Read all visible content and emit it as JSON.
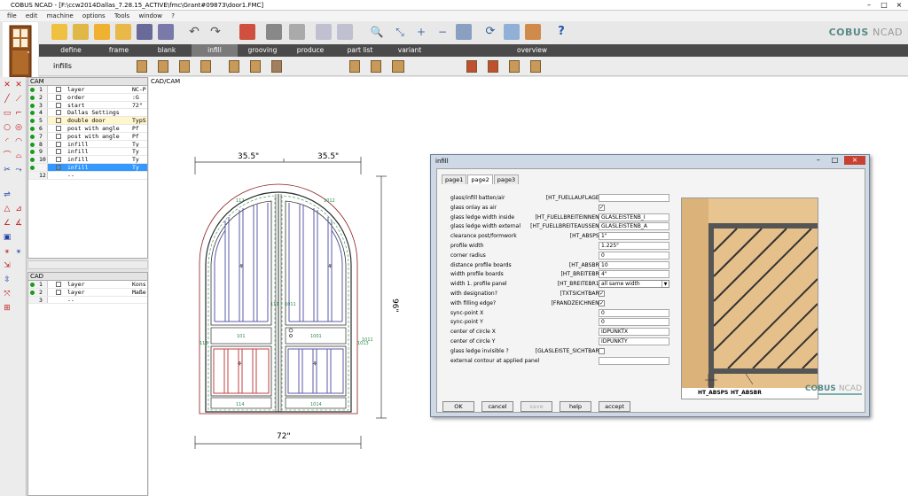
{
  "window": {
    "title": "COBUS NCAD - [F:\\ccw2014Dallas_7.28.15_ACTIVE\\fmc\\Grant#09873\\door1.FMC]",
    "minimize": "–",
    "maximize": "□",
    "close": "×"
  },
  "menu": [
    "file",
    "edit",
    "machine",
    "options",
    "Tools",
    "window",
    "?"
  ],
  "brand": {
    "a": "COBUS",
    "b": "NCAD"
  },
  "tabs": [
    {
      "label": "define"
    },
    {
      "label": "frame"
    },
    {
      "label": "blank"
    },
    {
      "label": "infill",
      "active": true
    },
    {
      "label": "grooving"
    },
    {
      "label": "produce"
    },
    {
      "label": "part list"
    },
    {
      "label": "variant"
    },
    {
      "label": "overview"
    }
  ],
  "subbar": {
    "label": "infills"
  },
  "cam": {
    "header": "CAM",
    "rows": [
      {
        "n": "1",
        "name": "layer",
        "val": "NC-P"
      },
      {
        "n": "2",
        "name": "order",
        "val": ":G"
      },
      {
        "n": "3",
        "name": "start",
        "val": "72\" :"
      },
      {
        "n": "4",
        "name": "Dallas Settings",
        "val": ""
      },
      {
        "n": "5",
        "name": "double door",
        "val": "TypS"
      },
      {
        "n": "6",
        "name": "post with angle",
        "val": "Pf"
      },
      {
        "n": "7",
        "name": "post with angle",
        "val": "Pf"
      },
      {
        "n": "8",
        "name": "infill",
        "val": "Ty"
      },
      {
        "n": "9",
        "name": "infill",
        "val": "Ty"
      },
      {
        "n": "10",
        "name": "infill",
        "val": "Ty"
      },
      {
        "n": "11",
        "name": "infill",
        "val": "Ty"
      },
      {
        "n": "12",
        "name": "--",
        "val": ""
      }
    ]
  },
  "cad": {
    "header": "CAD",
    "rows": [
      {
        "n": "1",
        "name": "layer",
        "val": "Kons"
      },
      {
        "n": "2",
        "name": "layer",
        "val": "Maße"
      },
      {
        "n": "3",
        "name": "--",
        "val": ""
      }
    ]
  },
  "viewport": {
    "label": "CAD/CAM"
  },
  "drawing": {
    "dim_left": "35.5\"",
    "dim_right": "35.5\"",
    "dim_bottom": "72\"",
    "dim_height": "96\"",
    "labels": [
      "112",
      "1012",
      "111",
      "1011",
      "101",
      "1001",
      "113",
      "1013",
      "1011",
      "114",
      "1014"
    ]
  },
  "dialog": {
    "title": "infill",
    "tabs": [
      "page1",
      "page2",
      "page3"
    ],
    "active_tab": "page2",
    "fields": [
      {
        "label": "glass/infill batten/air",
        "code": "[HT_FUELLAUFLAGE]",
        "type": "input",
        "value": ""
      },
      {
        "label": "glass onlay as air",
        "code": "",
        "type": "check",
        "value": "✓"
      },
      {
        "label": "glass ledge width inside",
        "code": "[HT_FUELLBREITEINNEN]",
        "type": "input",
        "value": "GLASLEISTENB_I"
      },
      {
        "label": "glass ledge width external",
        "code": "[HT_FUELLBREITEAUSSEN]",
        "type": "input",
        "value": "GLASLEISTENB_A"
      },
      {
        "label": "clearance post/formwork",
        "code": "[HT_ABSPS]",
        "type": "input",
        "value": "1\""
      },
      {
        "label": "profile width",
        "code": "",
        "type": "input",
        "value": "1.225\""
      },
      {
        "label": "corner radius",
        "code": "",
        "type": "input",
        "value": "0"
      },
      {
        "label": "distance profile boards",
        "code": "[HT_ABSBR]",
        "type": "input",
        "value": "10"
      },
      {
        "label": "width profile boards",
        "code": "[HT_BREITEBR]",
        "type": "input",
        "value": "4\""
      },
      {
        "label": "width 1. profile panel",
        "code": "[HT_BREITEBR1]",
        "type": "select",
        "value": "all same width"
      },
      {
        "label": "with designation?",
        "code": "[TXTSICHTBAR]",
        "type": "check",
        "value": "✓"
      },
      {
        "label": "with filling edge?",
        "code": "[FRANDZEICHNEN]",
        "type": "check",
        "value": "✓"
      },
      {
        "label": "sync-point X",
        "code": "",
        "type": "input",
        "value": "0"
      },
      {
        "label": "sync-point Y",
        "code": "",
        "type": "input",
        "value": "0"
      },
      {
        "label": "center of circle X",
        "code": "",
        "type": "input",
        "value": "IDPUNKTX"
      },
      {
        "label": "center of circle Y",
        "code": "",
        "type": "input",
        "value": "IDPUNKTY"
      },
      {
        "label": "glass ledge invisible ?",
        "code": "[GLASLEISTE_SICHTBAR]",
        "type": "check",
        "value": ""
      },
      {
        "label": "external contour at applied panel",
        "code": "",
        "type": "input",
        "value": ""
      }
    ],
    "preview_labels": {
      "a": "HT_ABSPS",
      "b": "HT_ABSBR"
    },
    "buttons": [
      {
        "label": "OK",
        "enabled": true
      },
      {
        "label": "cancel",
        "enabled": true
      },
      {
        "label": "save",
        "enabled": false
      },
      {
        "label": "help",
        "enabled": true
      },
      {
        "label": "accept",
        "enabled": true
      }
    ],
    "brand": {
      "a": "COBUS",
      "b": "NCAD"
    }
  },
  "colors": {
    "tabbar": "#4a4a4a",
    "selection": "#3399ff",
    "status_dot": "#1a9a1a",
    "wood": "#e6c08a",
    "dialog_frame": "#cfd9e6"
  }
}
